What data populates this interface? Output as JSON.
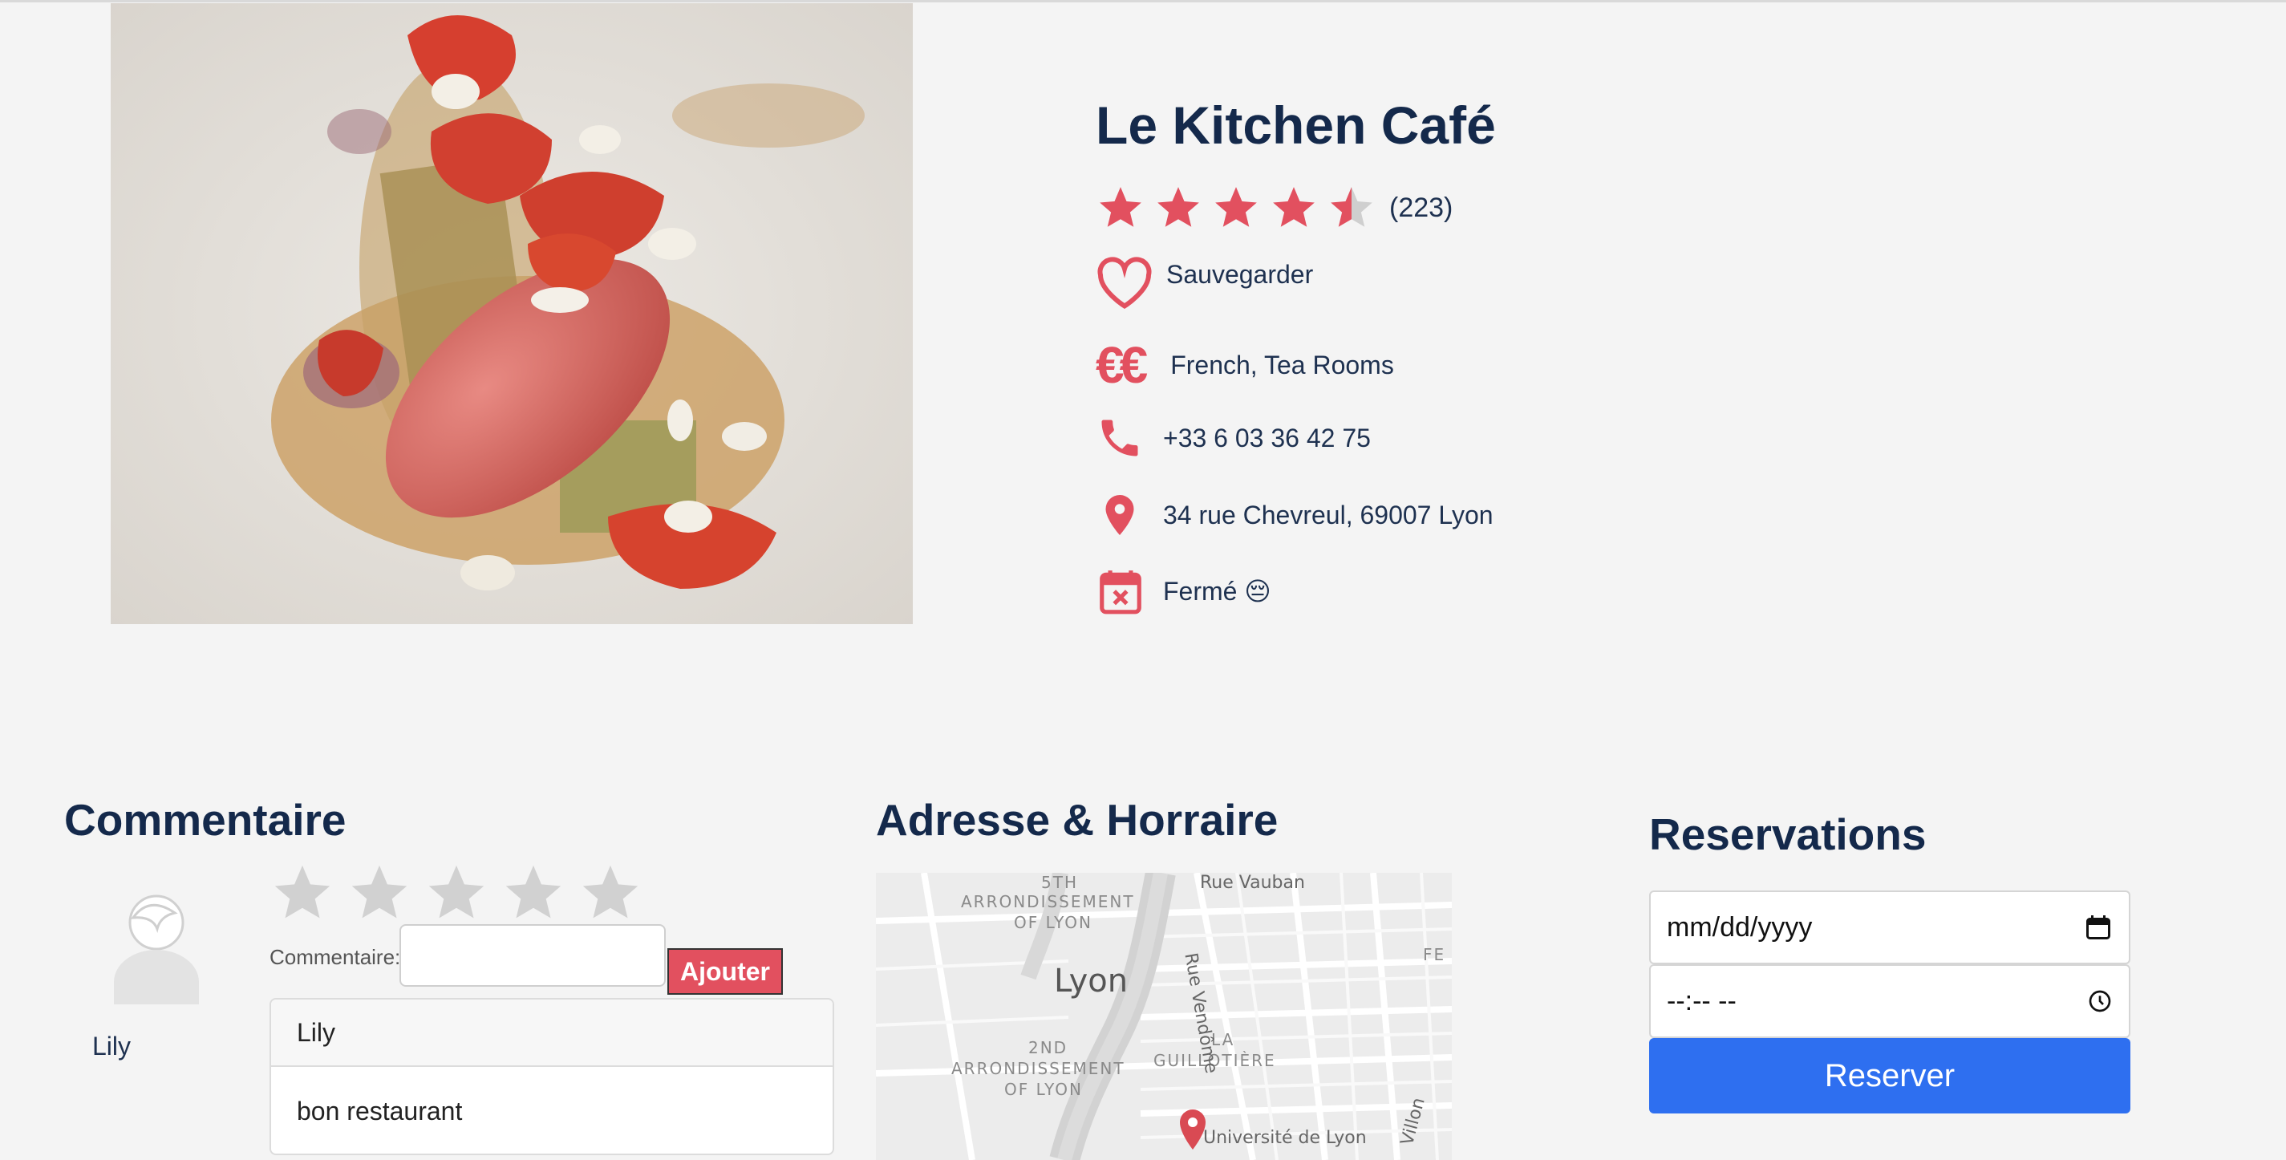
{
  "restaurant": {
    "name": "Le Kitchen Café",
    "rating": 4.5,
    "rating_count": "(223)",
    "save_label": "Sauvegarder",
    "price_symbol": "€€",
    "cuisine": "French, Tea Rooms",
    "phone": "+33 6 03 36 42 75",
    "address": "34 rue Chevreul, 69007 Lyon",
    "status": "Fermé 😔"
  },
  "comments": {
    "title": "Commentaire",
    "user_name": "Lily",
    "input_label": "Commentaire:",
    "input_value": "",
    "add_label": "Ajouter",
    "list": [
      {
        "author": "Lily",
        "text": "bon restaurant"
      }
    ]
  },
  "address_section": {
    "title": "Adresse & Horraire",
    "map": {
      "city": "Lyon",
      "districts": [
        "5TH",
        "ARRONDISSEMENT",
        "OF LYON",
        "2ND",
        "ARRONDISSEMENT",
        "OF LYON",
        "LA",
        "GUILLOTIÈRE",
        "FE"
      ],
      "streets": [
        "Rue Vauban",
        "Rue Vendôme",
        "Villon"
      ],
      "poi": "Université de Lyon"
    }
  },
  "reservations": {
    "title": "Reservations",
    "date_placeholder": "mm/dd/yyyy",
    "time_placeholder": "--:-- --",
    "button_label": "Reserver"
  },
  "colors": {
    "accent": "#e2505f",
    "heading": "#14294b",
    "primary_button": "#2e6ff0",
    "background": "#f4f4f4"
  },
  "icons": {
    "rating": "star-icon",
    "save": "heart-icon",
    "price": "euro-icon",
    "phone": "phone-icon",
    "address": "map-pin-icon",
    "hours": "calendar-x-icon",
    "avatar": "user-avatar-icon",
    "date": "calendar-icon",
    "time": "clock-icon"
  }
}
